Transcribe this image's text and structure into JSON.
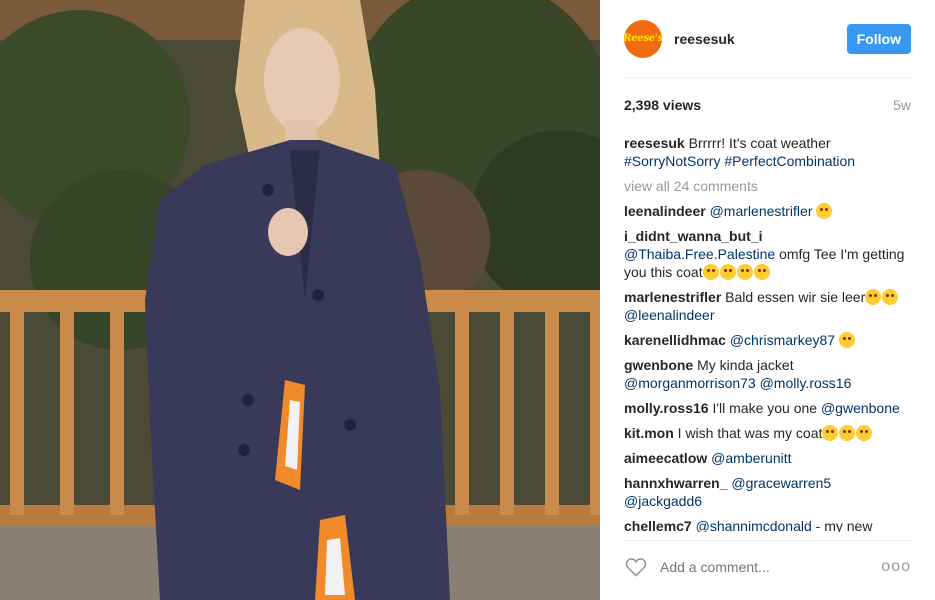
{
  "post": {
    "username": "reesesuk",
    "avatar_text": "Reese's",
    "follow_label": "Follow",
    "views": "2,398 views",
    "age": "5w"
  },
  "caption": {
    "username": "reesesuk",
    "text": "Brrrrr! It's coat weather",
    "tags": "#SorryNotSorry #PerfectCombination"
  },
  "view_all": "view all 24 comments",
  "comments": [
    {
      "user": "leenalindeer",
      "mention": "@marlenestrifler",
      "text": "",
      "emoji": 1
    },
    {
      "user": "i_didnt_wanna_but_i",
      "mention": "@Thaiba.Free.Palestine",
      "text": "omfg Tee I'm getting you this coat",
      "emoji": 4
    },
    {
      "user": "marlenestrifler",
      "mention": "",
      "text": "Bald essen wir sie leer",
      "emoji": 2,
      "mention2": "@leenalindeer"
    },
    {
      "user": "karenellidhmac",
      "mention": "@chrismarkey87",
      "text": "",
      "emoji": 1
    },
    {
      "user": "gwenbone",
      "mention": "",
      "text": "My kinda jacket",
      "emoji": 0,
      "mention2": "@morganmorrison73 @molly.ross16"
    },
    {
      "user": "molly.ross16",
      "mention": "",
      "text": "I'll make you one",
      "emoji": 0,
      "mention2": "@gwenbone"
    },
    {
      "user": "kit.mon",
      "mention": "",
      "text": "I wish that was my coat",
      "emoji": 3
    },
    {
      "user": "aimeecatlow",
      "mention": "@amberunitt",
      "text": "",
      "emoji": 0
    },
    {
      "user": "hannxhwarren_",
      "mention": "@gracewarren5 @jackgadd6",
      "text": "",
      "emoji": 0
    },
    {
      "user": "chellemc7",
      "mention": "@shannimcdonald",
      "text": "- my new",
      "emoji": 0
    }
  ],
  "footer": {
    "placeholder": "Add a comment...",
    "more": "ooo"
  },
  "colors": {
    "follow": "#3897f0",
    "link": "#003569",
    "muted": "#999999",
    "avatar": "#f26b0f"
  },
  "icons": [
    "heart-icon",
    "more-options-icon"
  ]
}
